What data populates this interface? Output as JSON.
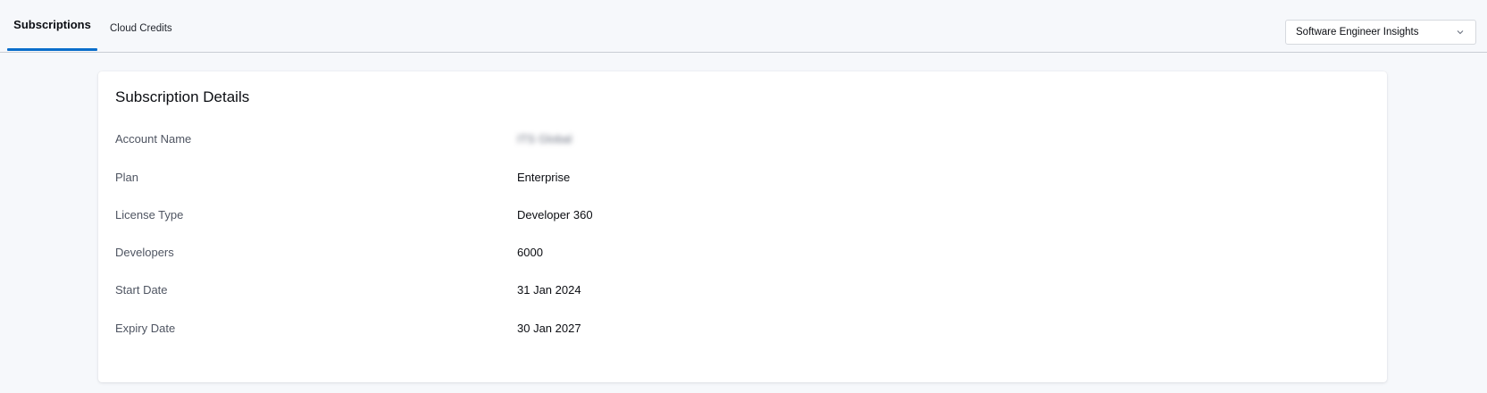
{
  "tabs": {
    "subscriptions": "Subscriptions",
    "cloud_credits": "Cloud Credits"
  },
  "module_select": {
    "value": "Software Engineer Insights"
  },
  "details": {
    "title": "Subscription Details",
    "rows": [
      {
        "label": "Account Name",
        "value": "ITS Global"
      },
      {
        "label": "Plan",
        "value": "Enterprise"
      },
      {
        "label": "License Type",
        "value": "Developer 360"
      },
      {
        "label": "Developers",
        "value": "6000"
      },
      {
        "label": "Start Date",
        "value": "31 Jan 2024"
      },
      {
        "label": "Expiry Date",
        "value": "30 Jan 2027"
      }
    ]
  },
  "icons": {
    "select_chevron": "chevron-down-icon"
  },
  "colors": {
    "accent": "#0a6ecb",
    "page_background": "#f6f8fb",
    "card_background": "#ffffff",
    "label_text": "#4f5562"
  }
}
